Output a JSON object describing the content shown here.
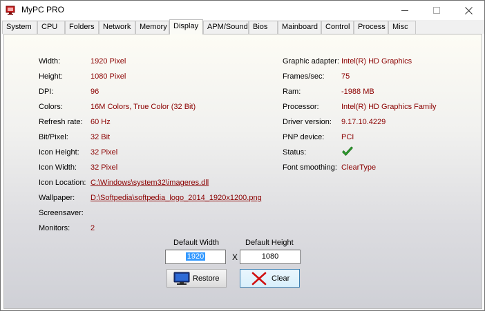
{
  "window": {
    "title": "MyPC PRO"
  },
  "tabs": [
    "System",
    "CPU",
    "Folders",
    "Network",
    "Memory",
    "Display",
    "APM/Sound",
    "Bios",
    "Mainboard",
    "Control",
    "Process",
    "Misc"
  ],
  "active_tab": "Display",
  "left": {
    "width_label": "Width:",
    "width_value": "1920 Pixel",
    "height_label": "Height:",
    "height_value": "1080 Pixel",
    "dpi_label": "DPI:",
    "dpi_value": "96",
    "colors_label": "Colors:",
    "colors_value": "16M Colors, True Color (32 Bit)",
    "refresh_label": "Refresh rate:",
    "refresh_value": "60 Hz",
    "bitpixel_label": "Bit/Pixel:",
    "bitpixel_value": "32 Bit",
    "iconheight_label": "Icon Height:",
    "iconheight_value": "32 Pixel",
    "iconwidth_label": "Icon Width:",
    "iconwidth_value": "32 Pixel",
    "iconloc_label": "Icon Location:",
    "iconloc_value": "C:\\Windows\\system32\\imageres.dll",
    "wallpaper_label": "Wallpaper:",
    "wallpaper_value": "D:\\Softpedia\\softpedia_logo_2014_1920x1200.png",
    "screensaver_label": "Screensaver:",
    "screensaver_value": "",
    "monitors_label": "Monitors:",
    "monitors_value": "2"
  },
  "right": {
    "adapter_label": "Graphic adapter:",
    "adapter_value": "Intel(R) HD Graphics",
    "fps_label": "Frames/sec:",
    "fps_value": "75",
    "ram_label": "Ram:",
    "ram_value": "-1988 MB",
    "processor_label": "Processor:",
    "processor_value": "Intel(R) HD Graphics Family",
    "driver_label": "Driver version:",
    "driver_value": "9.17.10.4229",
    "pnp_label": "PNP device:",
    "pnp_value": "PCI",
    "status_label": "Status:",
    "status_icon": "checkmark-icon",
    "fontsmooth_label": "Font smoothing:",
    "fontsmooth_value": "ClearType"
  },
  "defaults": {
    "width_caption": "Default Width",
    "height_caption": "Default  Height",
    "width_value": "1920",
    "height_value": "1080",
    "separator": "X"
  },
  "buttons": {
    "restore": "Restore",
    "clear": "Clear"
  },
  "colors": {
    "value_text": "#8b0000",
    "selection": "#3399ff",
    "check": "#2e9e2e",
    "clear_x": "#d01010"
  }
}
